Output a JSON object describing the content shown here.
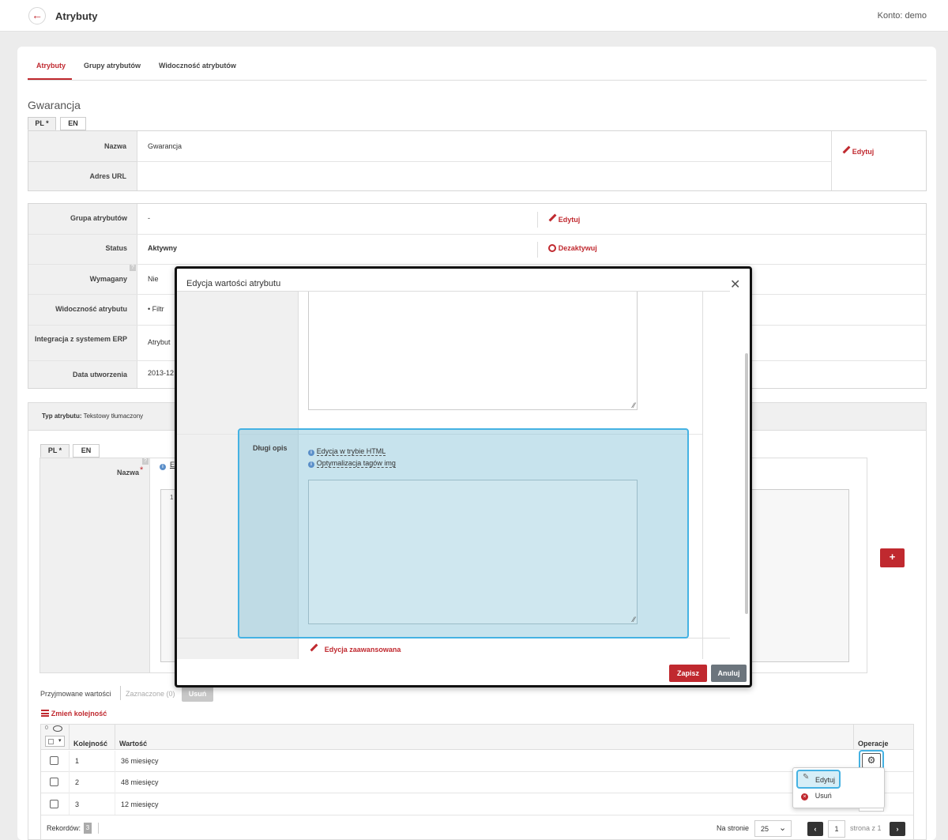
{
  "header": {
    "title": "Atrybuty",
    "account": "Konto: demo"
  },
  "tabs": [
    {
      "label": "Atrybuty"
    },
    {
      "label": "Grupy atrybutów"
    },
    {
      "label": "Widoczność atrybutów"
    }
  ],
  "section_title": "Gwarancja",
  "lang_tabs": {
    "pl": "PL *",
    "en": "EN"
  },
  "name_panel": {
    "name_label": "Nazwa",
    "name_value": "Gwarancja",
    "url_label": "Adres URL",
    "edit": "Edytuj"
  },
  "details": {
    "group_label": "Grupa atrybutów",
    "group_value": "-",
    "group_action": "Edytuj",
    "status_label": "Status",
    "status_value": "Aktywny",
    "status_action": "Dezaktywuj",
    "required_label": "Wymagany",
    "required_value": "Nie",
    "visibility_label": "Widoczność atrybutu",
    "visibility_value": "Filtr",
    "erp_label": "Integracja z systemem ERP",
    "erp_value": "Atrybut",
    "created_label": "Data utworzenia",
    "created_value": "2013-12"
  },
  "type_bar": {
    "label": "Typ atrybutu:",
    "value": "Tekstowy tłumaczony"
  },
  "value_editor": {
    "name_label": "Nazwa",
    "name_asterisk": "*",
    "partial_text": "E",
    "line_no": "1",
    "add_button": "+"
  },
  "accepted": {
    "label": "Przyjmowane wartości",
    "selected": "Zaznaczone (0)",
    "delete": "Usuń",
    "reorder": "Zmień kolejność"
  },
  "table": {
    "header_count": "0",
    "columns": {
      "order": "Kolejność",
      "value": "Wartość",
      "ops": "Operacje"
    },
    "rows": [
      {
        "order": "1",
        "value": "36 miesięcy"
      },
      {
        "order": "2",
        "value": "48 miesięcy"
      },
      {
        "order": "3",
        "value": "12 miesięcy"
      }
    ],
    "records_label": "Rekordów:",
    "records_count": "3",
    "per_page_label": "Na stronie",
    "per_page": "25",
    "page": "1",
    "page_of": "strona z 1"
  },
  "ops_menu": {
    "edit": "Edytuj",
    "delete": "Usuń"
  },
  "modal": {
    "title": "Edycja wartości atrybutu",
    "long_desc_label": "Długi opis",
    "html_link": "Edycja w trybie HTML",
    "img_link": "Optymalizacja tagów img",
    "advanced": "Edycja zaawansowana",
    "save": "Zapisz",
    "cancel": "Anuluj"
  },
  "colors": {
    "accent": "#c0292f",
    "highlight": "#45b2e3",
    "cancel": "#6c757d"
  }
}
